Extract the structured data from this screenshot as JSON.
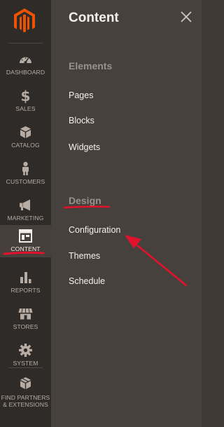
{
  "sidebar": {
    "items": [
      {
        "label": "DASHBOARD",
        "icon": "dashboard-gauge-icon"
      },
      {
        "label": "SALES",
        "icon": "dollar-icon"
      },
      {
        "label": "CATALOG",
        "icon": "box-icon"
      },
      {
        "label": "CUSTOMERS",
        "icon": "person-icon"
      },
      {
        "label": "MARKETING",
        "icon": "megaphone-icon"
      },
      {
        "label": "CONTENT",
        "icon": "layout-icon",
        "active": true
      },
      {
        "label": "REPORTS",
        "icon": "bar-chart-icon"
      },
      {
        "label": "STORES",
        "icon": "storefront-icon"
      },
      {
        "label": "SYSTEM",
        "icon": "gear-icon"
      },
      {
        "label": "FIND PARTNERS",
        "label2": "& EXTENSIONS",
        "icon": "partners-box-icon"
      }
    ]
  },
  "panel": {
    "title": "Content",
    "sections": [
      {
        "title": "Elements",
        "links": [
          "Pages",
          "Blocks",
          "Widgets"
        ]
      },
      {
        "title": "Design",
        "links": [
          "Configuration",
          "Themes",
          "Schedule"
        ]
      }
    ]
  },
  "colors": {
    "sidebar_bg": "#2f2b29",
    "panel_bg": "#47413d",
    "brand_orange": "#eb5202",
    "annotation_red": "#e3122c"
  }
}
